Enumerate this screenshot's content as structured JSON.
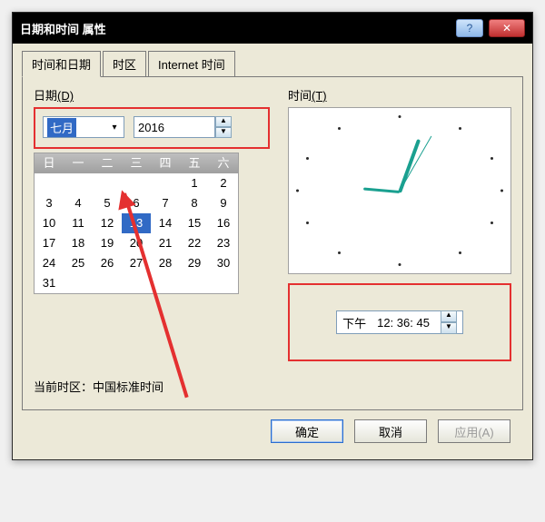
{
  "titlebar": {
    "title": "日期和时间 属性"
  },
  "tabs": {
    "time_date": "时间和日期",
    "timezone": "时区",
    "internet": "Internet 时间"
  },
  "date": {
    "label_prefix": "日期",
    "label_accel": "(D)",
    "month_value": "七月",
    "year_value": "2016",
    "weekdays": [
      "日",
      "一",
      "二",
      "三",
      "四",
      "五",
      "六"
    ],
    "grid": [
      [
        "",
        "",
        "",
        "",
        "",
        "1",
        "2"
      ],
      [
        "3",
        "4",
        "5",
        "6",
        "7",
        "8",
        "9"
      ],
      [
        "10",
        "11",
        "12",
        "13",
        "14",
        "15",
        "16"
      ],
      [
        "17",
        "18",
        "19",
        "20",
        "21",
        "22",
        "23"
      ],
      [
        "24",
        "25",
        "26",
        "27",
        "28",
        "29",
        "30"
      ],
      [
        "31",
        "",
        "",
        "",
        "",
        "",
        ""
      ]
    ],
    "selected_day": "13"
  },
  "time": {
    "label_prefix": "时间",
    "label_accel": "(T)",
    "ampm": "下午",
    "value": "12: 36: 45"
  },
  "timezone_line": {
    "label": "当前时区：",
    "value": "中国标准时间"
  },
  "buttons": {
    "ok": "确定",
    "cancel": "取消",
    "apply": "应用(A)"
  }
}
